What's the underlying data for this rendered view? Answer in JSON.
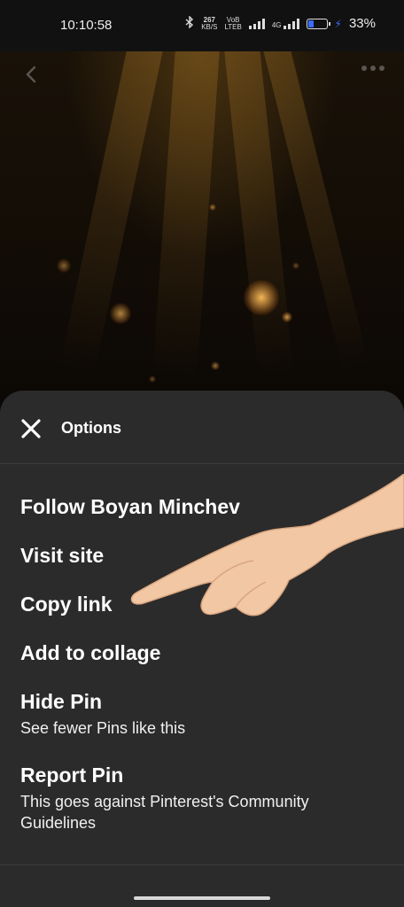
{
  "status_bar": {
    "time": "10:10:58",
    "net_speed_value": "267",
    "net_speed_unit": "KB/S",
    "volte_top": "VoB",
    "volte_bottom": "LTEB",
    "network": "4G",
    "battery_percent": "33%",
    "battery_level": 0.33
  },
  "header": {
    "back_icon": "chevron-left-icon",
    "more_icon": "more-horizontal-icon"
  },
  "sheet": {
    "title": "Options",
    "close_icon": "close-icon",
    "options": [
      {
        "label": "Follow Boyan Minchev"
      },
      {
        "label": "Visit site"
      },
      {
        "label": "Copy link"
      },
      {
        "label": "Add to collage"
      },
      {
        "label": "Hide Pin",
        "sublabel": "See fewer Pins like this"
      },
      {
        "label": "Report Pin",
        "sublabel": "This goes against Pinterest's Community Guidelines"
      }
    ]
  },
  "colors": {
    "sheet_background": "#2b2b2b",
    "accent_battery": "#3b6cff"
  }
}
